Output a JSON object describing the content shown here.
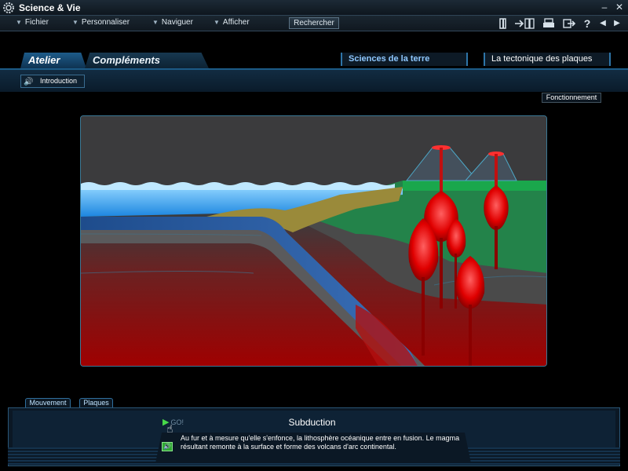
{
  "window": {
    "title": "Science & Vie",
    "minimize_glyph": "–",
    "close_glyph": "✕"
  },
  "menu": {
    "items": [
      {
        "label": "Fichier"
      },
      {
        "label": "Personnaliser"
      },
      {
        "label": "Naviguer"
      },
      {
        "label": "Afficher"
      }
    ],
    "search_label": "Rechercher"
  },
  "toolbar": {
    "icons": [
      "bookmark-icon",
      "export-icon",
      "print-icon",
      "exit-icon",
      "help-icon",
      "prev-icon",
      "next-icon"
    ],
    "help_glyph": "?",
    "prev_glyph": "◀",
    "next_glyph": "▶"
  },
  "tabs": [
    {
      "label": "Atelier",
      "active": true
    },
    {
      "label": "Compléments",
      "active": false
    }
  ],
  "breadcrumb": {
    "subject": "Sciences de la terre",
    "topic": "La tectonique des plaques"
  },
  "stage": {
    "intro_label": "Introduction",
    "fonctionnement_label": "Fonctionnement",
    "mouvement_label": "Mouvement",
    "plaques_label": "Plaques"
  },
  "panel": {
    "go_label": "GO!",
    "title": "Subduction",
    "description": "Au fur et à mesure qu'elle s'enfonce, la lithosphère océanique entre en fusion. Le magma résultant remonte à la surface et forme des volcans d'arc continental."
  },
  "colors": {
    "accent": "#2e75a8",
    "ocean": "#3aa8ff",
    "continent": "#1f8a4a",
    "magma": "#ff1f1f",
    "mantle": "#a00000"
  }
}
